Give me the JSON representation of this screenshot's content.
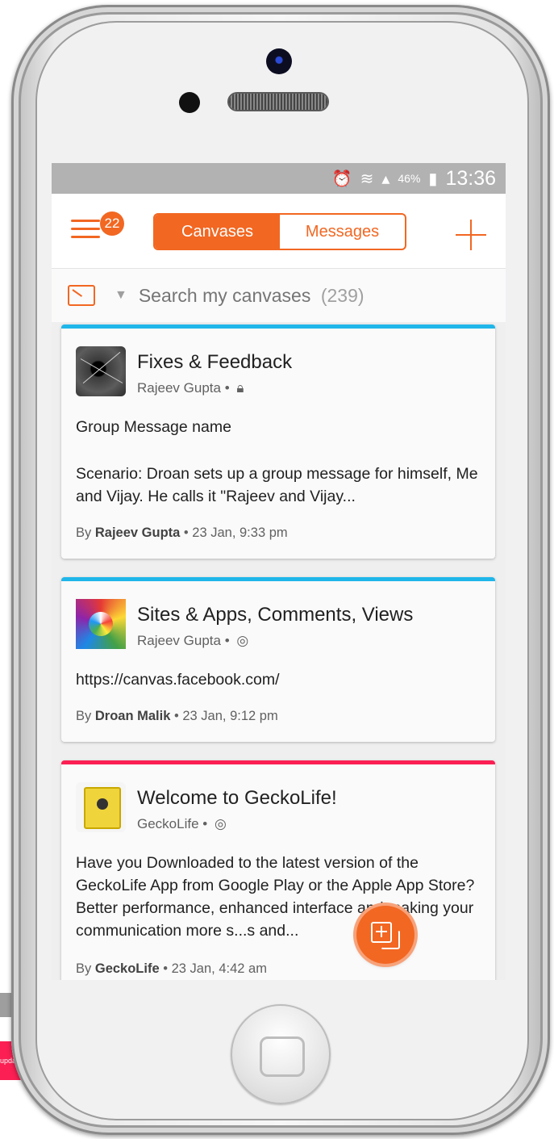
{
  "status_bar": {
    "battery_percent": "46%",
    "time": "13:36"
  },
  "header": {
    "notification_count": "22",
    "tabs": [
      {
        "label": "Canvases",
        "active": true
      },
      {
        "label": "Messages",
        "active": false
      }
    ]
  },
  "search": {
    "placeholder": "Search my canvases",
    "count": "(239)"
  },
  "cards": [
    {
      "title": "Fixes & Feedback",
      "author": "Rajeev Gupta",
      "privacy": "lock",
      "body_lines": [
        "Group Message name",
        "",
        "Scenario: Droan sets up a group message for himself, Me and Vijay. He calls it \"Rajeev and Vijay..."
      ],
      "body": "Group Message name",
      "body2": "Scenario: Droan sets up a group message for himself, Me and Vijay. He calls it \"Rajeev and Vijay...",
      "by_prefix": "By",
      "by_name": "Rajeev Gupta",
      "date": "23 Jan,  9:33 pm",
      "accent": "#1fb6ea"
    },
    {
      "title": "Sites & Apps, Comments, Views",
      "author": "Rajeev Gupta",
      "privacy": "globe",
      "body": "https://canvas.facebook.com/",
      "by_prefix": "By",
      "by_name": "Droan Malik",
      "date": "23 Jan,  9:12 pm",
      "accent": "#1fb6ea"
    },
    {
      "title": "Welcome to GeckoLife!",
      "author": "GeckoLife",
      "privacy": "globe",
      "body": "Have you Downloaded to the latest version of the GeckoLife App from Google Play or the Apple App Store? Better performance, enhanced interface and making your communication more s...s and...",
      "by_prefix": "By",
      "by_name": "GeckoLife",
      "date": "23 Jan,  4:42 am",
      "accent": "#fb1f53"
    }
  ],
  "side_peek": {
    "label": "updated"
  },
  "colors": {
    "accent": "#f26722",
    "status_bar": "#b2b2b2",
    "card_accent_blue": "#1fb6ea",
    "card_accent_pink": "#fb1f53"
  },
  "icons": {
    "menu": "hamburger-icon",
    "add": "plus-icon",
    "canvas": "canvas-icon",
    "lock": "lock-icon",
    "globe": "globe-icon",
    "fab": "new-canvas-icon",
    "alarm": "alarm-icon",
    "wifi": "wifi-icon",
    "signal": "signal-icon",
    "battery": "battery-icon"
  }
}
